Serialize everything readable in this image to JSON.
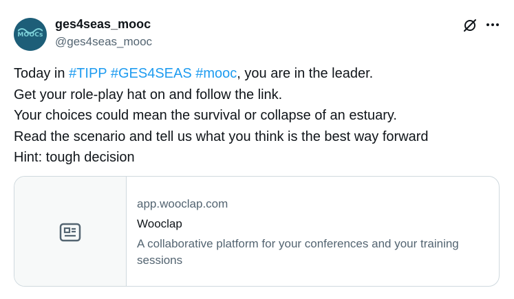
{
  "author": {
    "avatar_label": "MOOCs",
    "name": "ges4seas_mooc",
    "handle": "@ges4seas_mooc"
  },
  "actions": {
    "grok_icon": "grok-icon",
    "more_icon": "more-icon"
  },
  "tweet": {
    "line1_prefix": "Today in ",
    "hashtags": [
      "#TIPP",
      "#GES4SEAS",
      "#mooc"
    ],
    "line1_suffix": ", you are in the leader.",
    "line2": "Get your role-play hat on and follow the link.",
    "line3": "Your choices could mean the survival or collapse of an estuary.",
    "line4": "Read the scenario and tell us what you think is the best way forward",
    "line5": "Hint: tough decision"
  },
  "card": {
    "domain": "app.wooclap.com",
    "title": "Wooclap",
    "description": "A collaborative platform for your conferences and your training sessions",
    "thumbnail_icon": "article-icon"
  },
  "colors": {
    "link": "#1d9bf0",
    "text": "#0f1419",
    "secondary": "#536471",
    "border": "#cfd9de",
    "avatar_bg": "#1d5e78"
  }
}
